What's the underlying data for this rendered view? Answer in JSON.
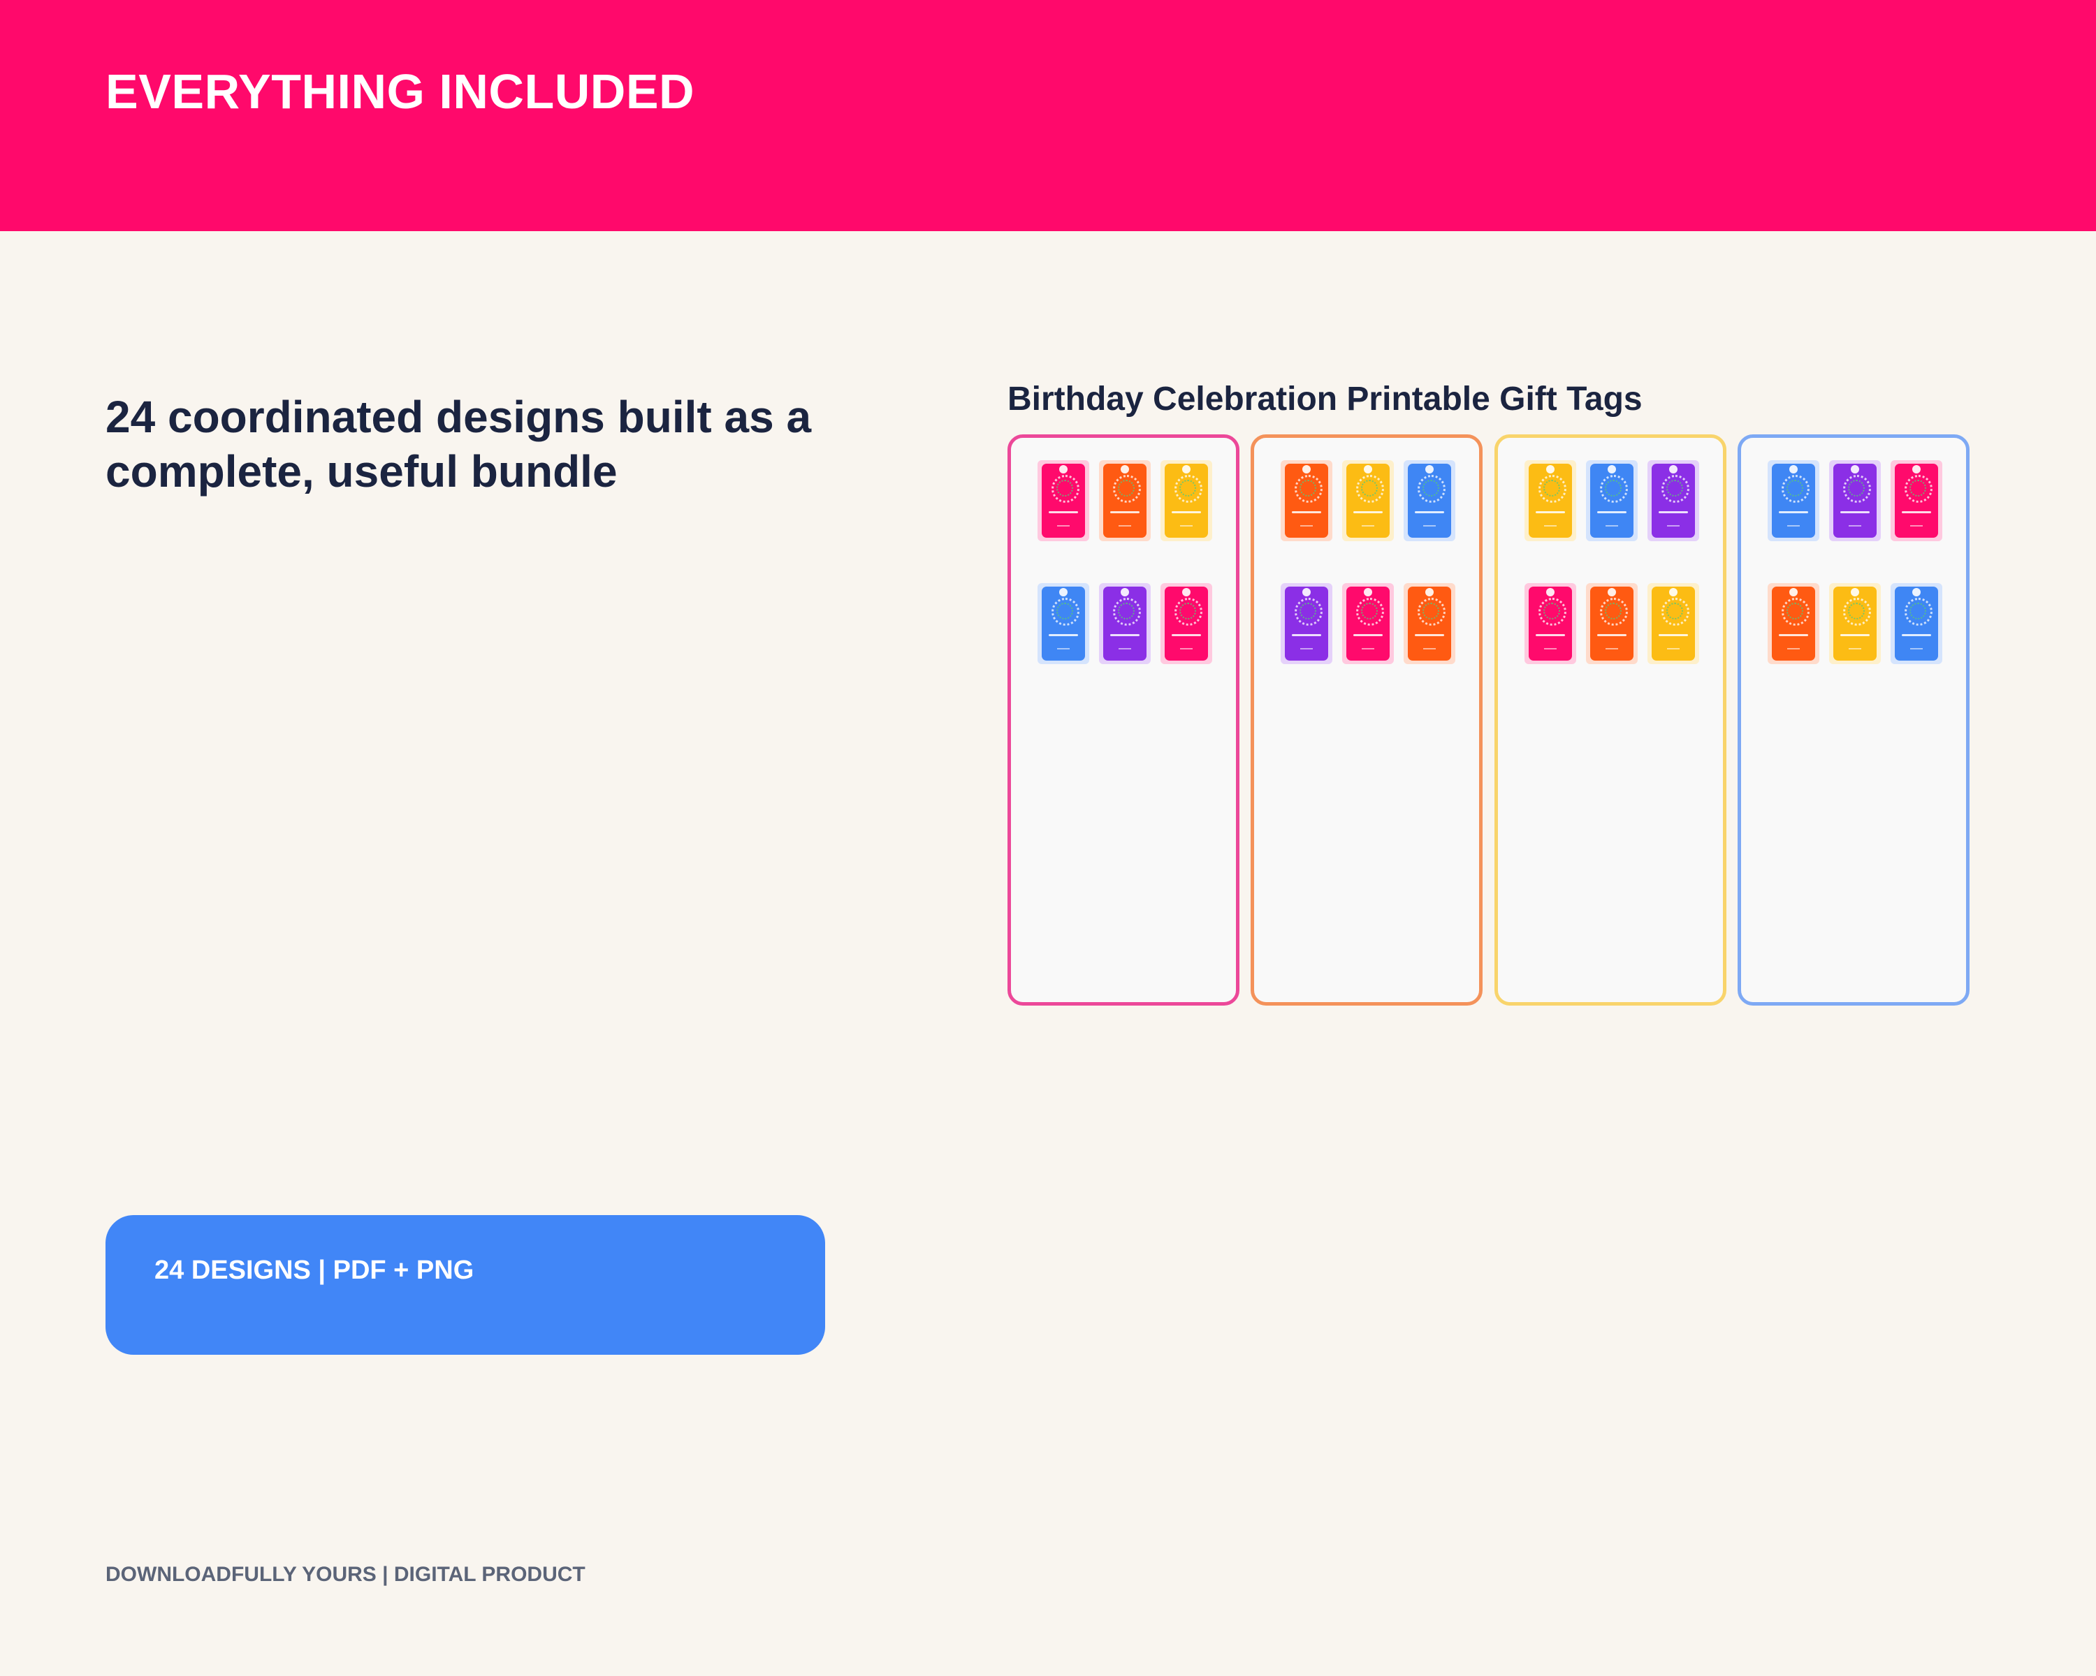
{
  "header": {
    "title": "EVERYTHING INCLUDED"
  },
  "headline": "24 coordinated designs built as a complete, useful bundle",
  "badge": {
    "label": "24 DESIGNS | PDF + PNG"
  },
  "footer": {
    "text": "DOWNLOADFULLY YOURS | DIGITAL PRODUCT"
  },
  "preview": {
    "title": "Birthday Celebration Printable Gift Tags",
    "panels": [
      {
        "border": "#ec4899",
        "tags": [
          "#ff0a6c",
          "#ff5a12",
          "#fcbc14",
          "#3f86f4",
          "#8b2fe6",
          "#ff0a6c"
        ]
      },
      {
        "border": "#f4925a",
        "tags": [
          "#ff5a12",
          "#fcbc14",
          "#3f86f4",
          "#8b2fe6",
          "#ff0a6c",
          "#ff5a12"
        ]
      },
      {
        "border": "#f9d46b",
        "tags": [
          "#fcbc14",
          "#3f86f4",
          "#8b2fe6",
          "#ff0a6c",
          "#ff5a12",
          "#fcbc14"
        ]
      },
      {
        "border": "#7ea9f4",
        "tags": [
          "#3f86f4",
          "#8b2fe6",
          "#ff0a6c",
          "#ff5a12",
          "#fcbc14",
          "#3f86f4"
        ]
      }
    ]
  },
  "colors": {
    "header_bg": "#ff096b",
    "page_bg": "#f9f5ef",
    "badge_bg": "#4186f7",
    "heading_text": "#1b2440",
    "footer_text": "#5b6478"
  }
}
